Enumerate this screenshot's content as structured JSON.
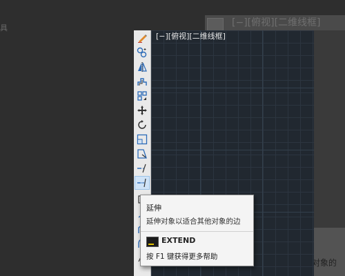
{
  "background": {
    "left_text": "具",
    "view_label": "[−][俯视][二维线框]",
    "bottom_text": "对象的"
  },
  "toolbar": {
    "name": "modify-toolbar",
    "tools": [
      {
        "name": "erase-icon"
      },
      {
        "name": "copy-icon"
      },
      {
        "name": "mirror-icon"
      },
      {
        "name": "offset-icon"
      },
      {
        "name": "array-icon"
      },
      {
        "name": "move-icon"
      },
      {
        "name": "rotate-icon"
      },
      {
        "name": "scale-icon"
      },
      {
        "name": "stretch-icon"
      },
      {
        "name": "trim-icon"
      },
      {
        "name": "extend-icon"
      }
    ],
    "active_tool": "extend-icon"
  },
  "viewport": {
    "label": "[−][俯视][二维线框]",
    "background_color": "#212830",
    "grid_color": "#2c3540"
  },
  "tooltip": {
    "title": "延伸",
    "description": "延伸对象以适合其他对象的边",
    "command": "EXTEND",
    "help": "按 F1 键获得更多帮助"
  }
}
